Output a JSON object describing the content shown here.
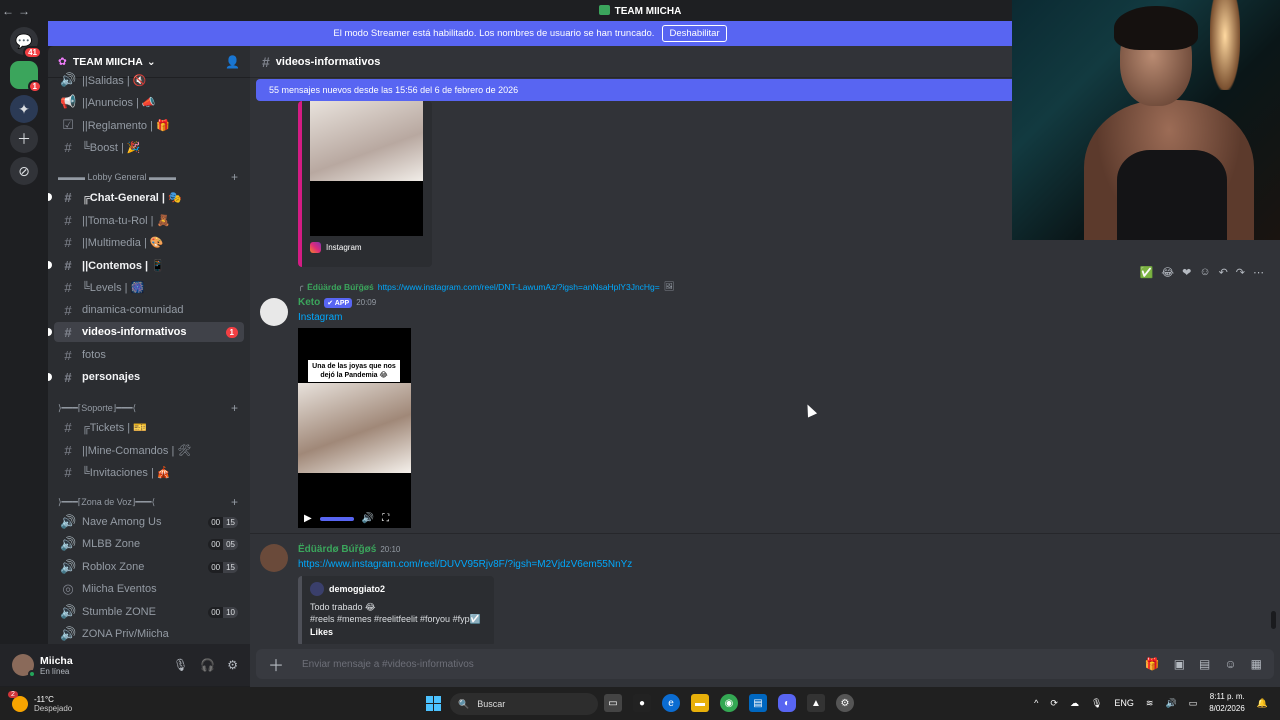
{
  "window": {
    "title": "TEAM MIICHA",
    "back": "←",
    "forward": "→"
  },
  "servers": {
    "dm_badge": "41",
    "server_badge": "1"
  },
  "streamer_banner": {
    "text": "El modo Streamer está habilitado. Los nombres de usuario se han truncado.",
    "button": "Deshabilitar"
  },
  "server": {
    "name": "TEAM MIICHA",
    "chevron": "⌄"
  },
  "channels": [
    {
      "label": "||Salidas | 🔇"
    },
    {
      "label": "||Anuncios | 📣"
    },
    {
      "label": "||Reglamento | 🎁"
    },
    {
      "label": "╚Boost | 🎉"
    }
  ],
  "category_lobby": "▬▬▬ Lobby General ▬▬▬",
  "lobby_channels": [
    {
      "label": "╔Chat-General | 🎭",
      "bold": true
    },
    {
      "label": "||Toma-tu-Rol | 🧸"
    },
    {
      "label": "||Multimedia | 🎨"
    },
    {
      "label": "||Contemos | 📱",
      "bold": true
    },
    {
      "label": "╚Levels | 🎆"
    },
    {
      "label": "dinamica-comunidad"
    },
    {
      "label": "videos-informativos",
      "active": true,
      "badge": "1"
    },
    {
      "label": "fotos"
    },
    {
      "label": "personajes",
      "bold": true
    }
  ],
  "category_support": "⟩━━━⌈Soporte⌋━━━⟨",
  "support_channels": [
    {
      "label": "╔Tickets | 🎫"
    },
    {
      "label": "||Mine-Comandos | 🛠"
    },
    {
      "label": "╚Invitaciones | 🎪"
    }
  ],
  "category_voice": "⟩━━━⌈Zona de Voz⌋━━━⟨",
  "voice_channels": [
    {
      "label": "Nave Among Us",
      "a": "00",
      "b": "15"
    },
    {
      "label": "MLBB Zone",
      "a": "00",
      "b": "05"
    },
    {
      "label": "Roblox Zone",
      "a": "00",
      "b": "15"
    },
    {
      "label": "Miicha Eventos"
    },
    {
      "label": "Stumble ZONE",
      "a": "00",
      "b": "10"
    },
    {
      "label": "ZONA Priv/Miicha"
    }
  ],
  "user": {
    "name": "Miicha",
    "status": "En línea"
  },
  "channel_header": {
    "name": "videos-informativos"
  },
  "new_messages": "55 mensajes nuevos desde las 15:56 del 6 de febrero de 2026",
  "embed1": {
    "provider": "Instagram"
  },
  "reply": {
    "name": "Ëdüärdø Búřğøś",
    "link": "https://www.instagram.com/reel/DNT-LawumAz/?igsh=anNsaHplY3JncHg="
  },
  "msg_keto": {
    "name": "Keto",
    "tag": "✔ APP",
    "time": "20:09",
    "link": "Instagram",
    "caption": "Una de las joyas que nos dejó la Pandemia 😂"
  },
  "msg_eduardo": {
    "name": "Ëdüärdø Búřğøś",
    "time": "20:10",
    "link": "https://www.instagram.com/reel/DUVV95Rjv8F/?igsh=M2VjdzV6em55NnYz"
  },
  "embed3": {
    "author": "demoggiato2",
    "text1": "Todo trabado 😂",
    "text2": "#reels #memes #reelitfeelit #foryou #fyp☑️",
    "likes": "Likes"
  },
  "composer": {
    "placeholder": "Enviar mensaje a #videos-informativos"
  },
  "taskbar": {
    "temp": "-11°C",
    "cond": "Despejado",
    "weather_badge": "2",
    "search": "Buscar",
    "lang": "ENG",
    "time": "8:11 p. m.",
    "date": "8/02/2026"
  }
}
